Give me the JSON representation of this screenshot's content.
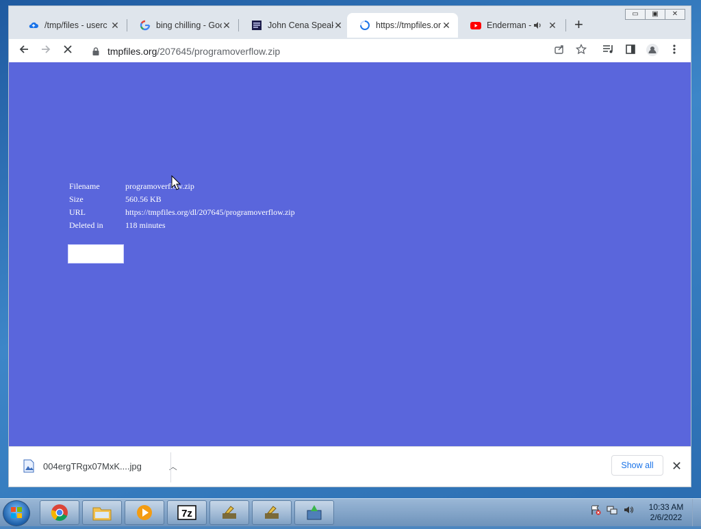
{
  "tabs": [
    {
      "title": "/tmp/files - userc",
      "icon": "cloud-icon"
    },
    {
      "title": "bing chilling - Goo",
      "icon": "google-icon"
    },
    {
      "title": "John Cena Speakin",
      "icon": "video-thumbnail-icon"
    },
    {
      "title": "https://tmpfiles.or",
      "icon": "loading-spinner-icon",
      "active": true
    },
    {
      "title": "Enderman - Yo",
      "icon": "youtube-icon",
      "audio": "speaker-icon"
    }
  ],
  "window_controls": {
    "minimize": "▭",
    "restore": "▣",
    "close": "✕"
  },
  "address": {
    "host": "tmpfiles.org",
    "path": "/207645/programoverflow.zip"
  },
  "file_info": [
    {
      "key": "Filename",
      "value": "programoverflow.zip"
    },
    {
      "key": "Size",
      "value": "560.56 KB"
    },
    {
      "key": "URL",
      "value": "https://tmpfiles.org/dl/207645/programoverflow.zip"
    },
    {
      "key": "Deleted in",
      "value": "118 minutes"
    }
  ],
  "downloads": {
    "file_name": "004ergTRgx07MxK....jpg",
    "show_all_label": "Show all"
  },
  "taskbar": {
    "items": [
      "chrome-icon",
      "explorer-icon",
      "media-player-icon",
      "7zip-icon",
      "keygen-icon",
      "keygen-icon",
      "installer-icon"
    ],
    "clock_time": "10:33 AM",
    "clock_date": "2/6/2022"
  },
  "colors": {
    "page_background": "#5a66dc",
    "tabstrip": "#dfe5ec",
    "link_blue": "#1a73e8"
  }
}
